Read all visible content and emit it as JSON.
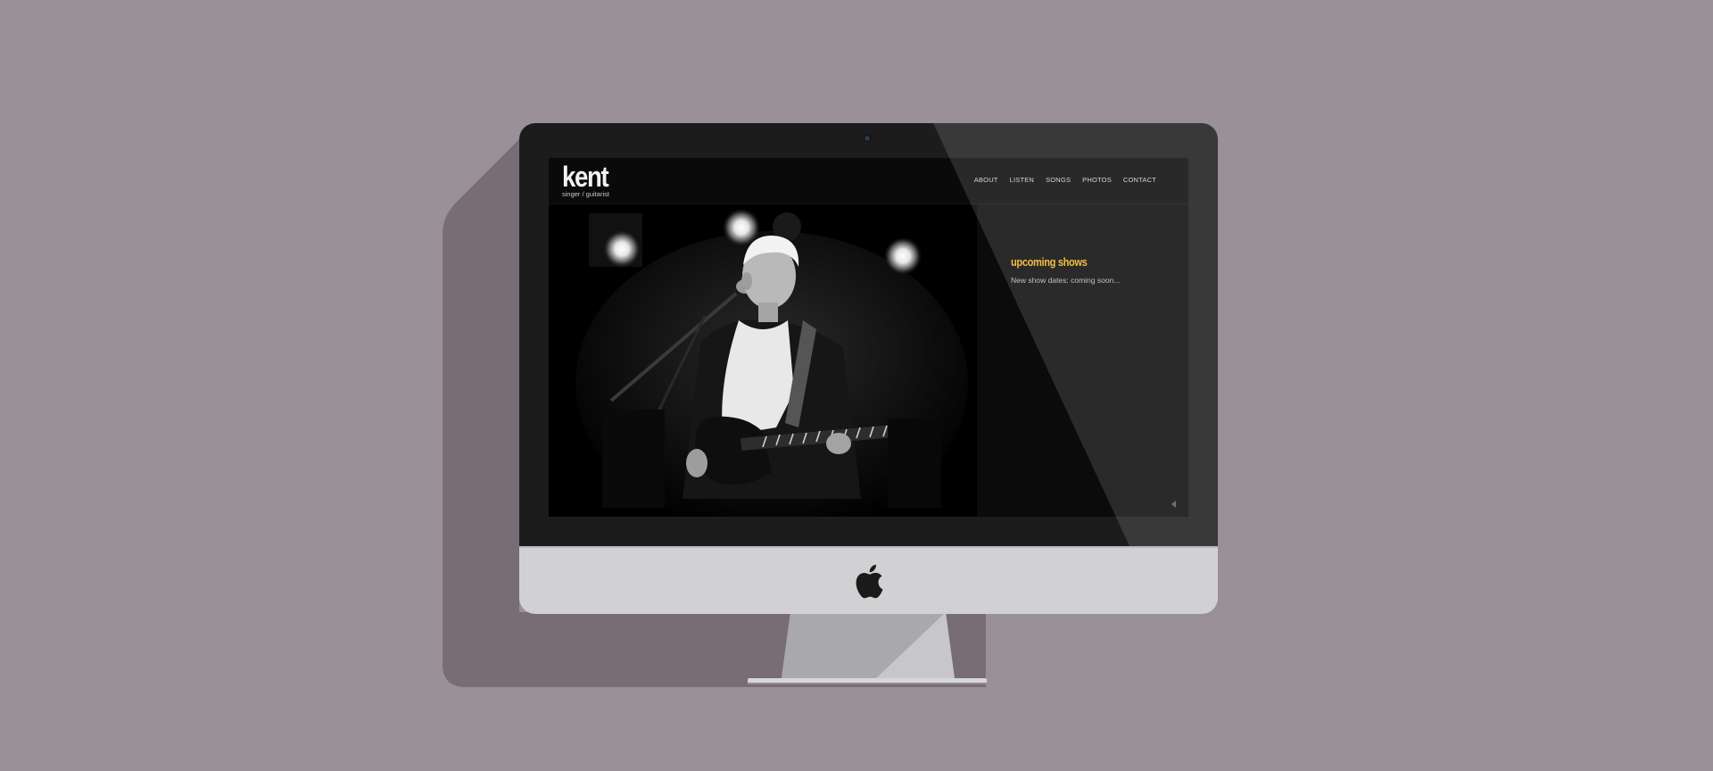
{
  "colors": {
    "background": "#9a9097",
    "long_shadow": "#786d74",
    "bezel": "#1c1c1c",
    "chin": "#d1d1d3",
    "stand": "#b0b0b2",
    "accent_heading": "#f0b428"
  },
  "site": {
    "logo": "kent",
    "tagline": "singer / guitarist",
    "nav": [
      {
        "label": "ABOUT"
      },
      {
        "label": "LISTEN"
      },
      {
        "label": "SONGS"
      },
      {
        "label": "PHOTOS"
      },
      {
        "label": "CONTACT"
      }
    ],
    "hero_image": "black-and-white photo of a guitarist singing at a microphone under stage lights",
    "sidebar": {
      "heading": "upcoming shows",
      "text": "New show dates: coming soon..."
    },
    "slider_arrow_icon": "left-triangle-icon"
  },
  "device": {
    "brand_icon": "apple-logo-icon",
    "camera_icon": "camera-dot-icon"
  }
}
